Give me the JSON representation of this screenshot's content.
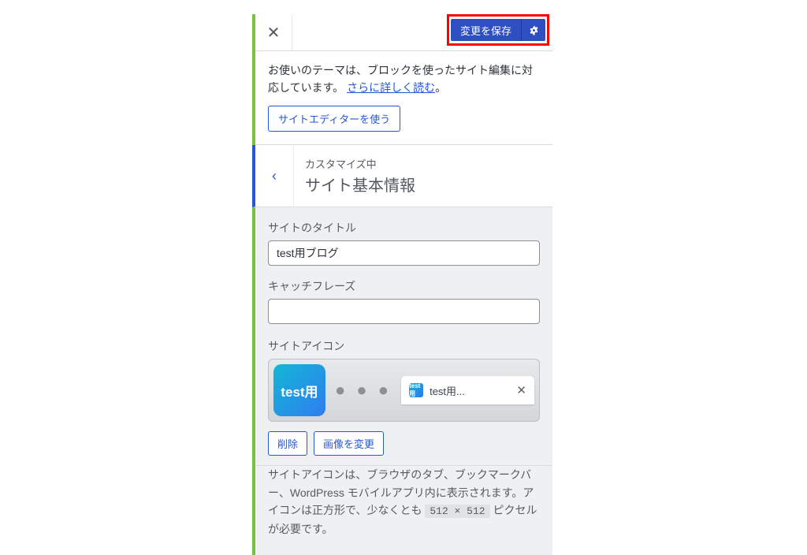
{
  "topbar": {
    "save_label": "変更を保存"
  },
  "notice": {
    "text_a": "お使いのテーマは、ブロックを使ったサイト編集に対応しています。",
    "link": "さらに詳しく読む",
    "text_b": "。",
    "button": "サイトエディターを使う"
  },
  "section": {
    "sup": "カスタマイズ中",
    "title": "サイト基本情報"
  },
  "form": {
    "title_label": "サイトのタイトル",
    "title_value": "test用ブログ",
    "tagline_label": "キャッチフレーズ",
    "tagline_value": "",
    "icon_label": "サイトアイコン"
  },
  "icon_preview": {
    "tile_text": "test用",
    "favicon_text": "test用",
    "tab_text": "test用...",
    "dots": "● ● ●"
  },
  "buttons": {
    "remove": "削除",
    "change": "画像を変更"
  },
  "help": {
    "t1": "サイトアイコンは、ブラウザのタブ、ブックマークバー、WordPress モバイルアプリ内に表示されます。アイコンは正方形で、少なくとも ",
    "size": "512 × 512",
    "t2": " ピクセルが必要です。"
  }
}
